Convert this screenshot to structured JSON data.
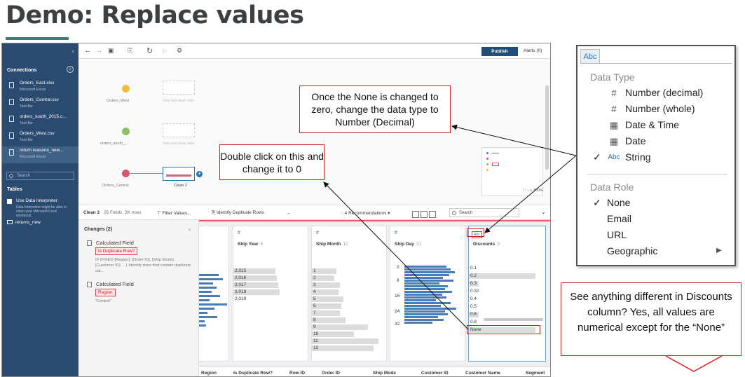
{
  "slide": {
    "title": "Demo: Replace values"
  },
  "sidebar": {
    "connections_heading": "Connections",
    "connections": [
      {
        "name": "Orders_East.xlsx",
        "type": "Microsoft Excel"
      },
      {
        "name": "Orders_Central.csv",
        "type": "Text file"
      },
      {
        "name": "orders_south_2015.c...",
        "type": "Text file"
      },
      {
        "name": "Orders_West.csv",
        "type": "Text file"
      },
      {
        "name": "return reasons_new...",
        "type": "Microsoft Excel"
      }
    ],
    "search_placeholder": "Search",
    "tables_heading": "Tables",
    "use_interpreter": "Use Data Interpreter",
    "interpreter_desc": "Data Interpreter might be able to clean your Microsoft Excel workbook.",
    "table": "returns_new"
  },
  "toolbar": {
    "publish": "Publish",
    "alerts": "Alerts (0)"
  },
  "flow": {
    "nodes": [
      {
        "label": "Orders_West",
        "ghost": "View and clean data"
      },
      {
        "label": "orders_south_...",
        "ghost": "View and clean data"
      },
      {
        "label": "Orders_Central",
        "step": "Clean 2"
      }
    ],
    "zoom": "100%"
  },
  "profile_toolbar": {
    "step": "Clean 2",
    "fields": "26 Fields",
    "rows": "2K rows",
    "filter": "Filter Values...",
    "identify": "Identify Duplicate Rows",
    "more": "...",
    "recommendations": "4 Recommendations",
    "search": "Search"
  },
  "changes": {
    "heading": "Changes (2)",
    "items": [
      {
        "type": "Calculated Field",
        "name": "Is Duplicate Row?",
        "detail": "IF {FIXED [Region], [Order ID], [Ship Mode], [Customer ID] ... } Identify rows that contain duplicate val..."
      },
      {
        "type": "Calculated Field",
        "name": "Region",
        "detail": "\"Central\""
      }
    ]
  },
  "cards": [
    {
      "name": "Ship Year",
      "count": "5",
      "values": [
        "2,015",
        "2,016",
        "2,017",
        "2,018",
        "2,019"
      ]
    },
    {
      "name": "Ship Month",
      "count": "12",
      "values": [
        "1",
        "2",
        "3",
        "4",
        "5",
        "6",
        "7",
        "8",
        "9",
        "10",
        "11",
        "12"
      ]
    },
    {
      "name": "Ship Day",
      "count": "31",
      "ticks": [
        "0",
        "8",
        "16",
        "24",
        "32"
      ]
    },
    {
      "name": "Discounts",
      "count": "9",
      "type_badge": "Abc",
      "values": [
        "0.1",
        "0.2",
        "0.3",
        "0.32",
        "0.4",
        "0.5",
        "0.6",
        "0.8",
        "None"
      ]
    }
  ],
  "grid_headers": [
    "Region",
    "Is Duplicate Row?",
    "Row ID",
    "Order ID",
    "Ship Mode",
    "Customer ID",
    "Customer Name",
    "Segment"
  ],
  "callouts": {
    "none_changed": "Once the None is changed to zero, change the data type to Number (Decimal)",
    "double_click": "Double click on this and change it to 0",
    "see_different": "See anything different in Discounts column? Yes, all values are numerical except for the “None”"
  },
  "datatype_menu": {
    "tab": "Abc",
    "data_type_heading": "Data Type",
    "types": [
      {
        "label": "Number (decimal)",
        "icon": "#",
        "checked": false
      },
      {
        "label": "Number (whole)",
        "icon": "#",
        "checked": false
      },
      {
        "label": "Date & Time",
        "icon": "calendar-clock",
        "checked": false
      },
      {
        "label": "Date",
        "icon": "calendar",
        "checked": false
      },
      {
        "label": "String",
        "icon": "Abc",
        "checked": true
      }
    ],
    "data_role_heading": "Data Role",
    "roles": [
      {
        "label": "None",
        "checked": true
      },
      {
        "label": "Email",
        "checked": false
      },
      {
        "label": "URL",
        "checked": false
      },
      {
        "label": "Geographic",
        "checked": false,
        "submenu": true
      }
    ]
  },
  "colors": {
    "accent": "#1f4e79",
    "sidebar": "#2b4a6f",
    "highlight": "#d62020"
  }
}
